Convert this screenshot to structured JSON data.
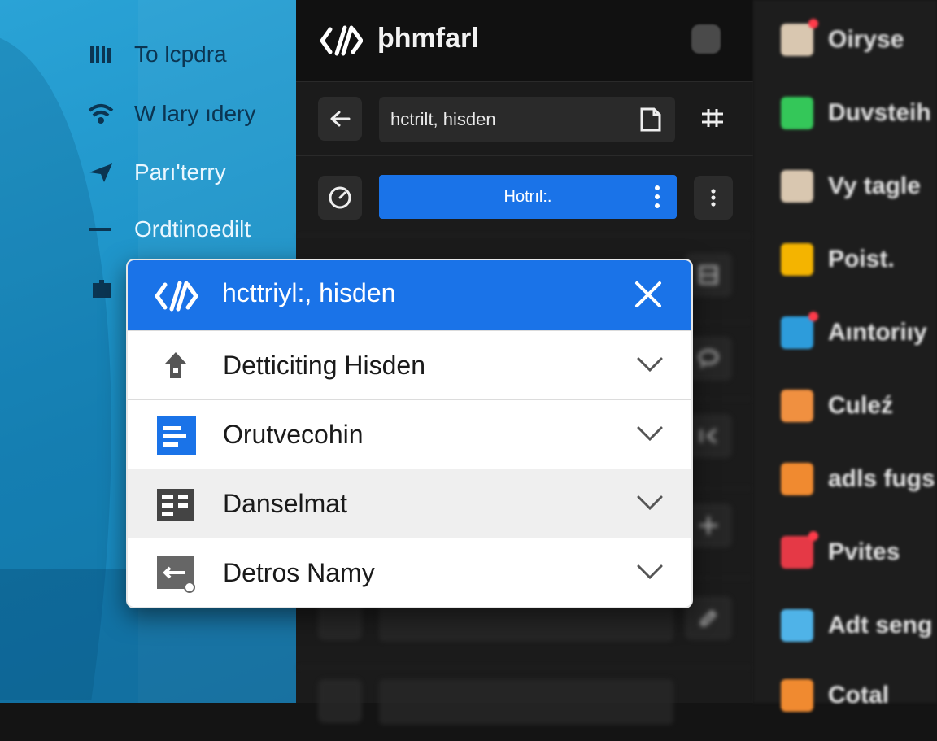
{
  "left_sidebar": {
    "items": [
      {
        "label": "To lcpdra",
        "icon": "library-icon"
      },
      {
        "label": "W lary ıdery",
        "icon": "wifi-icon"
      },
      {
        "label": "Parı'terry",
        "icon": "send-icon"
      },
      {
        "label": "Ordtinoedilt",
        "icon": "minus-icon"
      }
    ]
  },
  "main": {
    "app_title": "þhmfarl",
    "search_field": "hctrilt, hisden",
    "primary_button": "Hotrıl:."
  },
  "dialog": {
    "title": "hcttriyl:, hisden",
    "rows": [
      {
        "label": "Detticiting Hisden"
      },
      {
        "label": "Orutvecohin"
      },
      {
        "label": "Danselmat"
      },
      {
        "label": "Detros Namy"
      }
    ]
  },
  "right_sidebar": {
    "items": [
      {
        "label": "Oiryse",
        "color": "#d9d9d9"
      },
      {
        "label": "Duvsteih",
        "color": "#34c759"
      },
      {
        "label": "Vy tagle",
        "color": "#d9d9d9"
      },
      {
        "label": "Poist.",
        "color": "#f4b400"
      },
      {
        "label": "Aıntoriıy",
        "color": "#2d9cdb"
      },
      {
        "label": "Culeź",
        "color": "#f09040"
      },
      {
        "label": "adls fugs",
        "color": "#f08a30"
      },
      {
        "label": "Pvites",
        "color": "#e53946"
      },
      {
        "label": "Adt seng",
        "color": "#4fb3e8"
      },
      {
        "label": "Cotal",
        "color": "#f08a30"
      }
    ]
  },
  "colors": {
    "accent": "#1a73e8",
    "left_bg": "#1c92c9",
    "dark_bg": "#1b1b1b"
  }
}
